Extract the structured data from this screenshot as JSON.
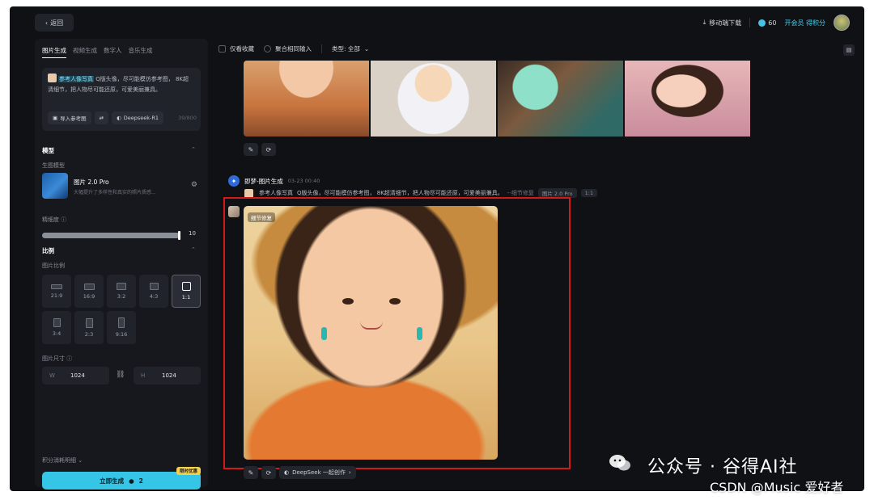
{
  "topbar": {
    "back_label": "返回",
    "mobile_download": "移动端下载",
    "credits": "60",
    "vip_label": "开会员 得积分"
  },
  "sidebar": {
    "tabs": [
      "图片生成",
      "视频生成",
      "数字人",
      "音乐生成"
    ],
    "prompt": {
      "ref_label": "参考人像写真",
      "text": "Q版头像，尽可能模仿参考图， 8K超清细节，把人物尽可能还原，可爱美丽兼具。",
      "import_ref": "导入参考图",
      "deepseek": "Deepseek-R1",
      "count": "39/800"
    },
    "model_section": {
      "title": "模型",
      "sub": "生图模型",
      "model_name": "图片 2.0 Pro",
      "model_desc": "大幅提升了多样性和真实的照片质感..."
    },
    "fineness": {
      "label": "精细度",
      "value": "10",
      "fraction": 1.0
    },
    "ratio_section": {
      "title": "比例",
      "sub": "图片比例",
      "ratios": [
        "21:9",
        "16:9",
        "3:2",
        "4:3",
        "1:1",
        "3:4",
        "2:3",
        "9:16"
      ],
      "selected": "1:1"
    },
    "size_section": {
      "sub": "图片尺寸",
      "w_label": "W",
      "w_value": "1024",
      "h_label": "H",
      "h_value": "1024"
    },
    "credit_detail": "积分消耗明细",
    "generate_label": "立即生成",
    "generate_cost": "2",
    "generate_badge": "限时优惠"
  },
  "main": {
    "filters": {
      "favorites": "仅看收藏",
      "merge": "聚合相同输入",
      "type": "类型: 全部"
    },
    "message": {
      "title": "即梦-图片生成",
      "time": "03-23  00:40",
      "ref_label": "参考人像写真",
      "prompt": "Q版头像，尽可能模仿参考图， 8K超清细节，把人物尽可能还原，可爱美丽兼具。",
      "detail_tag": "--细节修复",
      "model_tag": "图片 2.0 Pro",
      "ratio_tag": "1:1",
      "image_badge": "细节修复",
      "deepseek_btn": "DeepSeek 一起创作"
    }
  },
  "watermark": {
    "line1": "公众号 · 谷得AI社",
    "line2": "CSDN @Music 爱好者"
  },
  "colors": {
    "accent": "#35c5e6",
    "highlight_frame": "#d11a1a",
    "background": "#0f1115"
  }
}
